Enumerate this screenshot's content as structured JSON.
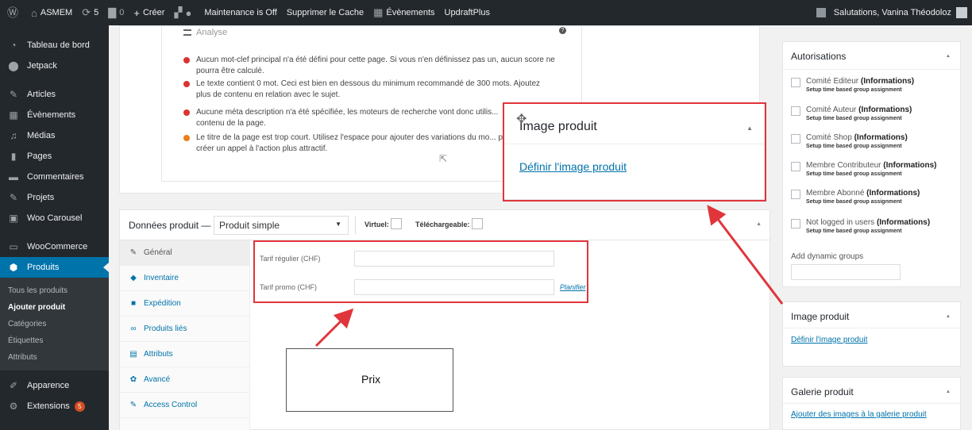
{
  "adminbar": {
    "site_name": "ASMEM",
    "updates_count": "5",
    "comments_count": "0",
    "new_label": "Créer",
    "maintenance": "Maintenance is Off",
    "clear_cache": "Supprimer le Cache",
    "events": "Évènements",
    "updraft": "UpdraftPlus",
    "greeting": "Salutations, Vanina Théodoloz"
  },
  "sidebar": {
    "items": [
      {
        "label": "Tableau de bord",
        "icon": "dashboard-icon"
      },
      {
        "label": "Jetpack",
        "icon": "jetpack-icon"
      },
      {
        "label": "Articles",
        "icon": "pin-icon"
      },
      {
        "label": "Évènements",
        "icon": "calendar-icon"
      },
      {
        "label": "Médias",
        "icon": "media-icon"
      },
      {
        "label": "Pages",
        "icon": "page-icon"
      },
      {
        "label": "Commentaires",
        "icon": "comment-icon"
      },
      {
        "label": "Projets",
        "icon": "pin-icon"
      },
      {
        "label": "Woo Carousel",
        "icon": "carousel-icon"
      },
      {
        "label": "WooCommerce",
        "icon": "woocommerce-icon"
      },
      {
        "label": "Produits",
        "icon": "box-icon"
      },
      {
        "label": "Apparence",
        "icon": "brush-icon"
      },
      {
        "label": "Extensions",
        "icon": "plugin-icon",
        "badge": "5"
      }
    ],
    "submenu": [
      "Tous les produits",
      "Ajouter produit",
      "Catégories",
      "Étiquettes",
      "Attributs"
    ]
  },
  "seo": {
    "heading": "Analyse",
    "items": [
      {
        "color": "red",
        "text": "Aucun mot-clef principal n'a été défini pour cette page. Si vous n'en définissez pas un, aucun score ne pourra être calculé."
      },
      {
        "color": "red",
        "text": "Le texte contient 0 mot. Ceci est bien en dessous du minimum recommandé de 300 mots. Ajoutez plus de contenu en relation avec le sujet."
      },
      {
        "color": "red",
        "text": "Aucune méta description n'a été spécifiée, les moteurs de recherche vont donc utilis... contenu de la page."
      },
      {
        "color": "orange",
        "text": "Le titre de la page est trop court. Utilisez l'espace pour ajouter des variations du mo... pour créer un appel à l'action plus attractif."
      }
    ]
  },
  "product_data": {
    "title": "Données produit —",
    "type_selected": "Produit simple",
    "virtual_label": "Virtuel:",
    "downloadable_label": "Téléchargeable:",
    "tabs": [
      {
        "label": "Général",
        "icon": "wrench-icon"
      },
      {
        "label": "Inventaire",
        "icon": "tag-icon"
      },
      {
        "label": "Expédition",
        "icon": "truck-icon"
      },
      {
        "label": "Produits liés",
        "icon": "link-icon"
      },
      {
        "label": "Attributs",
        "icon": "table-icon"
      },
      {
        "label": "Avancé",
        "icon": "gear-icon"
      },
      {
        "label": "Access Control",
        "icon": "wrench-icon"
      }
    ],
    "regular_price_label": "Tarif régulier (CHF)",
    "sale_price_label": "Tarif promo (CHF)",
    "schedule_link": "Planifier"
  },
  "authorisations": {
    "title": "Autorisations",
    "items": [
      {
        "name": "Comité Editeur",
        "bold": "(Informations)",
        "sub": "Setup time based group assignment"
      },
      {
        "name": "Comité Auteur",
        "bold": "(Informations)",
        "sub": "Setup time based group assignment"
      },
      {
        "name": "Comité Shop",
        "bold": "(Informations)",
        "sub": "Setup time based group assignment"
      },
      {
        "name": "Membre Contributeur",
        "bold": "(Informations)",
        "sub": "Setup time based group assignment"
      },
      {
        "name": "Membre Abonné",
        "bold": "(Informations)",
        "sub": "Setup time based group assignment"
      },
      {
        "name": "Not logged in users",
        "bold": "(Informations)",
        "sub": "Setup time based group assignment"
      }
    ],
    "dynamic_label": "Add dynamic groups"
  },
  "image_box": {
    "title": "Image produit",
    "link": "Définir l'image produit"
  },
  "gallery_box": {
    "title": "Galerie produit",
    "link": "Ajouter des images à la galerie produit"
  },
  "zoom_popup": {
    "title": "Image produit",
    "link": "Définir l'image produit"
  },
  "annotation": {
    "prix_label": "Prix",
    "color": "#e0353b"
  }
}
